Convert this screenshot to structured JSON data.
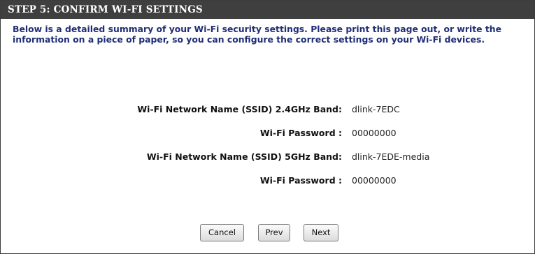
{
  "header": {
    "title": "STEP 5: CONFIRM WI-FI SETTINGS"
  },
  "intro": {
    "text": "Below is a detailed summary of your Wi-Fi security settings. Please print this page out, or write the information on a piece of paper, so you can configure the correct settings on your Wi-Fi devices."
  },
  "settings": [
    {
      "label": "Wi-Fi Network Name (SSID)  2.4GHz Band:",
      "value": "dlink-7EDC"
    },
    {
      "label": "Wi-Fi Password :",
      "value": "00000000"
    },
    {
      "label": "Wi-Fi Network Name (SSID)  5GHz Band:",
      "value": "dlink-7EDE-media"
    },
    {
      "label": "Wi-Fi Password :",
      "value": "00000000"
    }
  ],
  "buttons": {
    "cancel_label": "Cancel",
    "prev_label": "Prev",
    "next_label": "Next"
  },
  "colors": {
    "header_background": "#3f3f3f",
    "intro_text": "#1f2e75"
  }
}
